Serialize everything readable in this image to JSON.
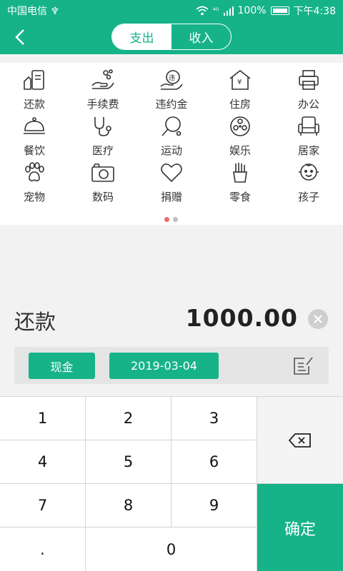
{
  "status_bar": {
    "carrier": "中国电信 ♆",
    "network": "⁴ᴳ",
    "battery": "100%",
    "time": "下午4:38"
  },
  "header": {
    "tabs": [
      {
        "label": "支出",
        "active": true
      },
      {
        "label": "收入",
        "active": false
      }
    ]
  },
  "categories": [
    {
      "label": "还款",
      "icon": "repay-icon"
    },
    {
      "label": "手续费",
      "icon": "fee-icon"
    },
    {
      "label": "违约金",
      "icon": "penalty-icon"
    },
    {
      "label": "住房",
      "icon": "housing-icon"
    },
    {
      "label": "办公",
      "icon": "printer-icon"
    },
    {
      "label": "餐饮",
      "icon": "dining-icon"
    },
    {
      "label": "医疗",
      "icon": "stethoscope-icon"
    },
    {
      "label": "运动",
      "icon": "ping-pong-icon"
    },
    {
      "label": "娱乐",
      "icon": "film-reel-icon"
    },
    {
      "label": "居家",
      "icon": "armchair-icon"
    },
    {
      "label": "宠物",
      "icon": "paw-icon"
    },
    {
      "label": "数码",
      "icon": "camera-icon"
    },
    {
      "label": "捐赠",
      "icon": "heart-icon"
    },
    {
      "label": "零食",
      "icon": "fries-icon"
    },
    {
      "label": "孩子",
      "icon": "baby-icon"
    }
  ],
  "page_dots": {
    "count": 2,
    "active": 0
  },
  "entry": {
    "category": "还款",
    "amount": "1000.00",
    "account": "现金",
    "date": "2019-03-04"
  },
  "keypad": {
    "keys": [
      "1",
      "2",
      "3",
      "4",
      "5",
      "6",
      "7",
      "8",
      "9",
      ".",
      "0"
    ],
    "confirm": "确定"
  },
  "colors": {
    "accent": "#16b389",
    "dot_active": "#ef6b6b"
  }
}
